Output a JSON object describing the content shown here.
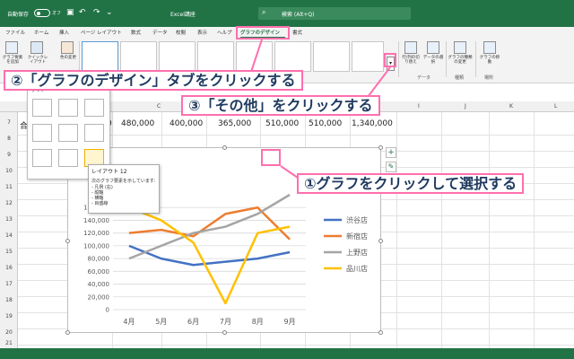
{
  "titlebar": {
    "autosave_label": "自動保存",
    "autosave_state": "オフ",
    "filename": "Excel講座",
    "search_placeholder": "検索 (Alt+Q)"
  },
  "tabs": [
    {
      "label": "ファイル"
    },
    {
      "label": "ホーム"
    },
    {
      "label": "挿入"
    },
    {
      "label": "ページ レイアウト"
    },
    {
      "label": "数式"
    },
    {
      "label": "データ"
    },
    {
      "label": "校閲"
    },
    {
      "label": "表示"
    },
    {
      "label": "ヘルプ"
    },
    {
      "label": "グラフのデザイン"
    },
    {
      "label": "書式"
    }
  ],
  "ribbon": {
    "add_element": "グラフ要素を追加",
    "quick_layout": "クイックレイアウト",
    "change_color": "色の変更",
    "switch_rowcol": "行/列の切り替え",
    "select_data": "データの選択",
    "change_type": "グラフの種類の変更",
    "move_chart": "グラフの移動",
    "group_data": "データ",
    "group_type": "種類",
    "group_location": "場所"
  },
  "layout_dropdown": {
    "label": "グラフ"
  },
  "tooltip": {
    "title": "レイアウト 12",
    "description": "次のグラフ要素を示しています:",
    "items": [
      "- 凡例 (右)",
      "- 縦軸",
      "- 横軸",
      "- 目盛線"
    ]
  },
  "columns": [
    "C",
    "D",
    "E",
    "F",
    "G",
    "H",
    "I",
    "J",
    "K",
    "L"
  ],
  "rows": [
    "7",
    "8",
    "9",
    "10",
    "11",
    "12",
    "13",
    "14",
    "15",
    "16",
    "17",
    "18",
    "19",
    "20",
    "21",
    "22"
  ],
  "row7": {
    "partial_a": "合",
    "partial_b": "0",
    "cells": [
      "480,000",
      "400,000",
      "365,000",
      "510,000",
      "510,000",
      "1,340,000"
    ]
  },
  "chart_data": {
    "type": "line",
    "categories": [
      "4月",
      "5月",
      "6月",
      "7月",
      "8月",
      "9月"
    ],
    "series": [
      {
        "name": "渋谷店",
        "color": "#4472c4",
        "values": [
          100000,
          80000,
          70000,
          75000,
          80000,
          90000
        ]
      },
      {
        "name": "新宿店",
        "color": "#ed7d31",
        "values": [
          120000,
          125000,
          115000,
          150000,
          160000,
          110000
        ]
      },
      {
        "name": "上野店",
        "color": "#a5a5a5",
        "values": [
          80000,
          100000,
          120000,
          130000,
          150000,
          180000
        ]
      },
      {
        "name": "品川店",
        "color": "#ffc000",
        "values": [
          160000,
          140000,
          105000,
          10000,
          120000,
          130000
        ]
      }
    ],
    "y_tick_labels": [
      "0",
      "20,000",
      "40,000",
      "60,000",
      "80,000",
      "100,000",
      "120,000",
      "140,000",
      "160,000"
    ],
    "ylim": [
      0,
      180000
    ],
    "legend": "right",
    "grid": true
  },
  "callouts": {
    "step1": "①グラフをクリックして選択する",
    "step2": "②「グラフのデザイン」タブをクリックする",
    "step3": "③「その他」をクリックする"
  },
  "colors": {
    "excel_green": "#217346",
    "highlight": "#ff6fae"
  }
}
